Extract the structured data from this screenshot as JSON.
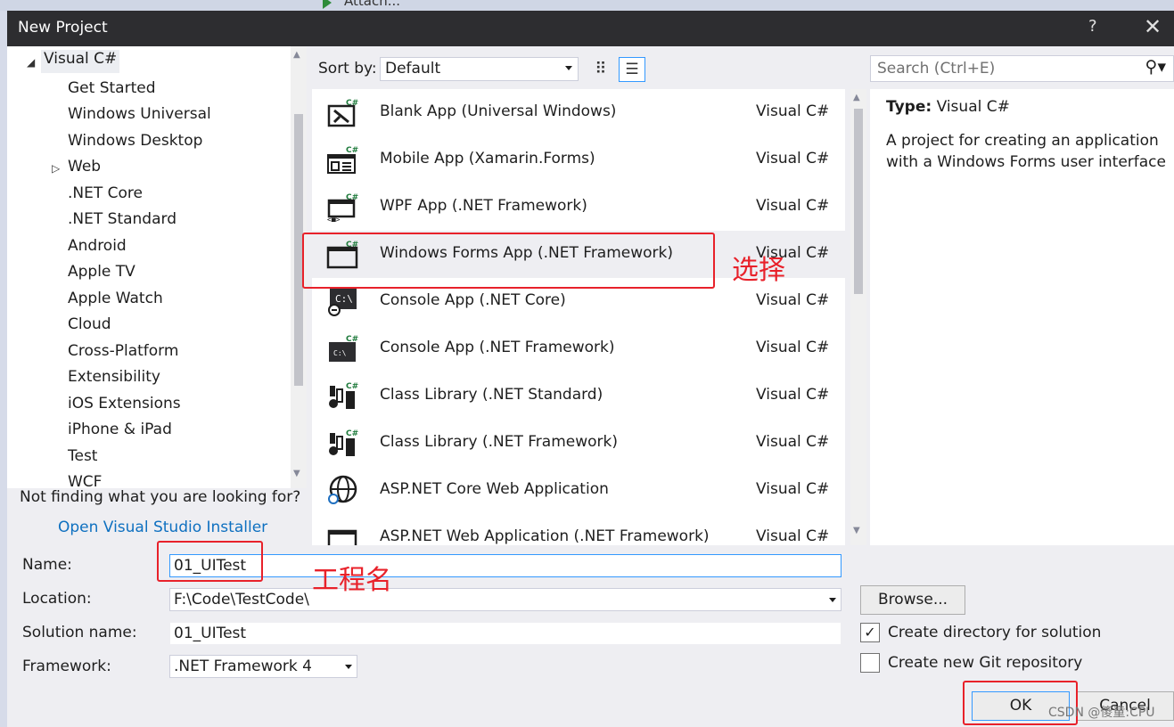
{
  "background": {
    "toolbar_fragment": "Attach..."
  },
  "window": {
    "title": "New Project",
    "help_glyph": "?",
    "close_glyph": "✕"
  },
  "tree": {
    "root": "Visual C#",
    "items": [
      "Get Started",
      "Windows Universal",
      "Windows Desktop",
      "Web",
      ".NET Core",
      ".NET Standard",
      "Android",
      "Apple TV",
      "Apple Watch",
      "Cloud",
      "Cross-Platform",
      "Extensibility",
      "iOS Extensions",
      "iPhone & iPad",
      "Test",
      "WCF"
    ],
    "not_finding": "Not finding what you are looking for?",
    "installer_link": "Open Visual Studio Installer"
  },
  "sort": {
    "label": "Sort by:",
    "value": "Default"
  },
  "search": {
    "placeholder": "Search (Ctrl+E)"
  },
  "templates": [
    {
      "name": "Blank App (Universal Windows)",
      "language": "Visual C#",
      "icon": "uwp-app-icon"
    },
    {
      "name": "Mobile App (Xamarin.Forms)",
      "language": "Visual C#",
      "icon": "mobile-app-icon"
    },
    {
      "name": "WPF App (.NET Framework)",
      "language": "Visual C#",
      "icon": "wpf-app-icon"
    },
    {
      "name": "Windows Forms App (.NET Framework)",
      "language": "Visual C#",
      "icon": "windows-forms-icon",
      "selected": true
    },
    {
      "name": "Console App (.NET Core)",
      "language": "Visual C#",
      "icon": "console-core-icon"
    },
    {
      "name": "Console App (.NET Framework)",
      "language": "Visual C#",
      "icon": "console-framework-icon"
    },
    {
      "name": "Class Library (.NET Standard)",
      "language": "Visual C#",
      "icon": "class-library-icon"
    },
    {
      "name": "Class Library (.NET Framework)",
      "language": "Visual C#",
      "icon": "class-library-icon"
    },
    {
      "name": "ASP.NET Core Web Application",
      "language": "Visual C#",
      "icon": "globe-icon"
    },
    {
      "name": "ASP.NET Web Application (.NET Framework)",
      "language": "Visual C#",
      "icon": "web-app-icon"
    }
  ],
  "details": {
    "type_label": "Type:",
    "type_value": "Visual C#",
    "description": "A project for creating an application with a Windows Forms user interface"
  },
  "form": {
    "name_label": "Name:",
    "name_value": "01_UITest",
    "location_label": "Location:",
    "location_value": "F:\\Code\\TestCode\\",
    "solution_label": "Solution name:",
    "solution_value": "01_UITest",
    "framework_label": "Framework:",
    "framework_value": ".NET Framework 4",
    "browse": "Browse...",
    "create_dir": "Create directory for solution",
    "create_dir_checked": true,
    "create_git": "Create new Git repository",
    "create_git_checked": false,
    "ok": "OK",
    "cancel": "Cancel"
  },
  "annotations": {
    "select": "选择",
    "project_name": "工程名"
  },
  "watermark": "CSDN @傻童:CPU",
  "colors": {
    "annotation_red": "#e8212a",
    "link_blue": "#0e70c0",
    "titlebar": "#2d2d30",
    "focus_blue": "#3399ff"
  }
}
